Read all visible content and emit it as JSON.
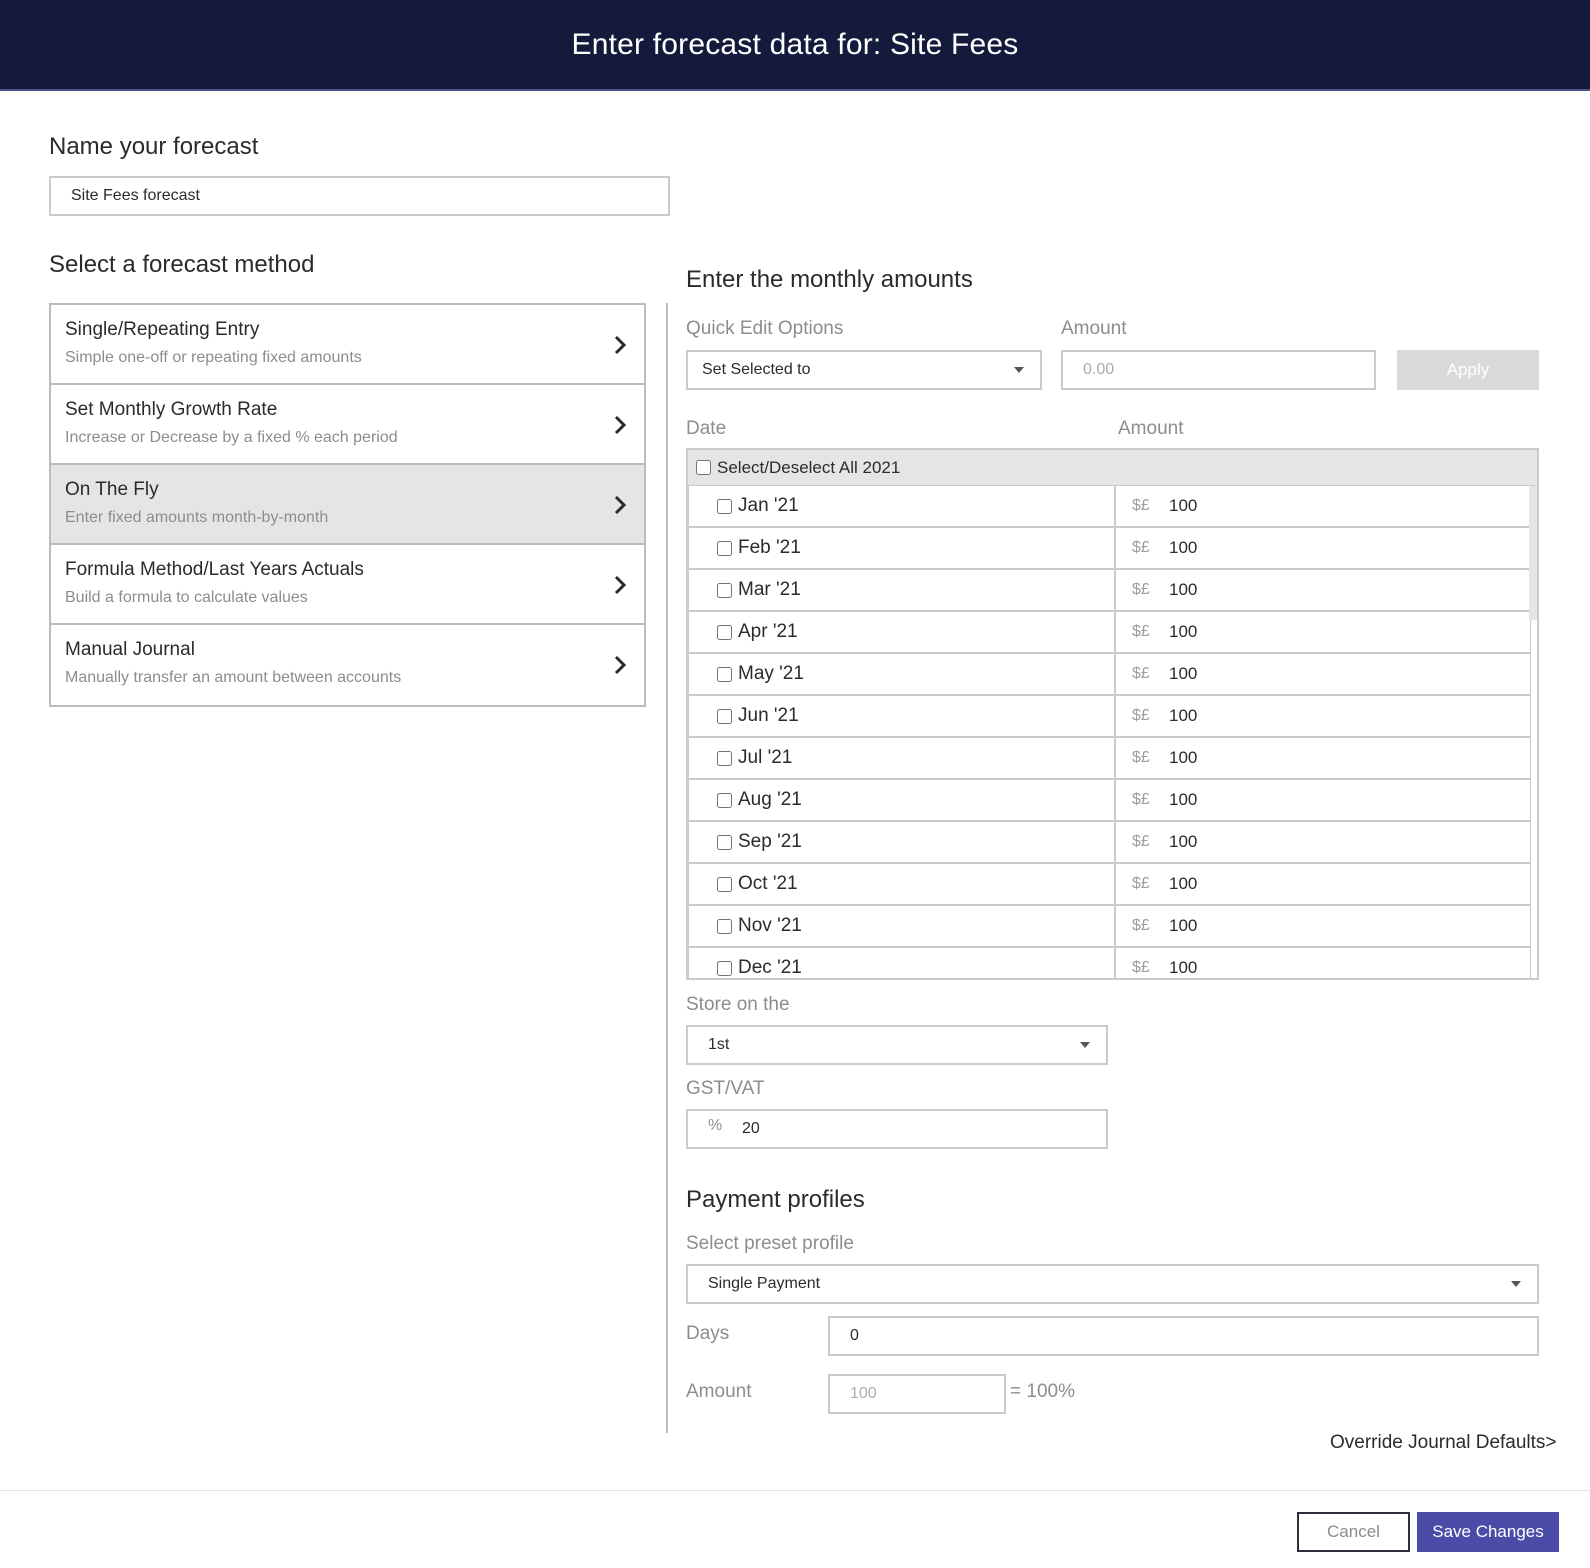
{
  "header": {
    "title": "Enter forecast data for: Site Fees"
  },
  "name_section": {
    "title": "Name your forecast",
    "value": "Site Fees forecast"
  },
  "method_section": {
    "title": "Select a forecast method",
    "methods": [
      {
        "title": "Single/Repeating Entry",
        "desc": "Simple one-off or repeating fixed amounts",
        "selected": false
      },
      {
        "title": "Set Monthly Growth Rate",
        "desc": "Increase or Decrease by a fixed % each period",
        "selected": false
      },
      {
        "title": "On The Fly",
        "desc": "Enter fixed amounts month-by-month",
        "selected": true
      },
      {
        "title": "Formula Method/Last Years Actuals",
        "desc": "Build a formula to calculate values",
        "selected": false
      },
      {
        "title": "Manual Journal",
        "desc": "Manually transfer an amount between accounts",
        "selected": false
      }
    ]
  },
  "monthly": {
    "title": "Enter the monthly amounts",
    "quick_edit_label": "Quick Edit Options",
    "quick_edit_value": "Set Selected to",
    "amount_label": "Amount",
    "amount_placeholder": "0.00",
    "apply_label": "Apply",
    "col_date": "Date",
    "col_amount": "Amount",
    "select_all_label": "Select/Deselect All 2021",
    "currency_symbol": "$£",
    "rows": [
      {
        "date": "Jan '21",
        "amount": "100"
      },
      {
        "date": "Feb '21",
        "amount": "100"
      },
      {
        "date": "Mar '21",
        "amount": "100"
      },
      {
        "date": "Apr '21",
        "amount": "100"
      },
      {
        "date": "May '21",
        "amount": "100"
      },
      {
        "date": "Jun '21",
        "amount": "100"
      },
      {
        "date": "Jul '21",
        "amount": "100"
      },
      {
        "date": "Aug '21",
        "amount": "100"
      },
      {
        "date": "Sep '21",
        "amount": "100"
      },
      {
        "date": "Oct '21",
        "amount": "100"
      },
      {
        "date": "Nov '21",
        "amount": "100"
      },
      {
        "date": "Dec '21",
        "amount": "100"
      }
    ]
  },
  "store": {
    "label": "Store on the",
    "value": "1st"
  },
  "gst": {
    "label": "GST/VAT",
    "prefix": "%",
    "value": "20"
  },
  "payment": {
    "title": "Payment profiles",
    "preset_label": "Select preset profile",
    "preset_value": "Single Payment",
    "days_label": "Days",
    "days_value": "0",
    "amount_label": "Amount",
    "amount_placeholder": "100",
    "amount_suffix": "= 100%"
  },
  "override_link": "Override Journal Defaults>",
  "footer": {
    "cancel_label": "Cancel",
    "save_label": "Save Changes"
  },
  "colors": {
    "header_bg": "#141a3c",
    "primary": "#4a4ca8",
    "selected_bg": "#e5e5e5"
  }
}
